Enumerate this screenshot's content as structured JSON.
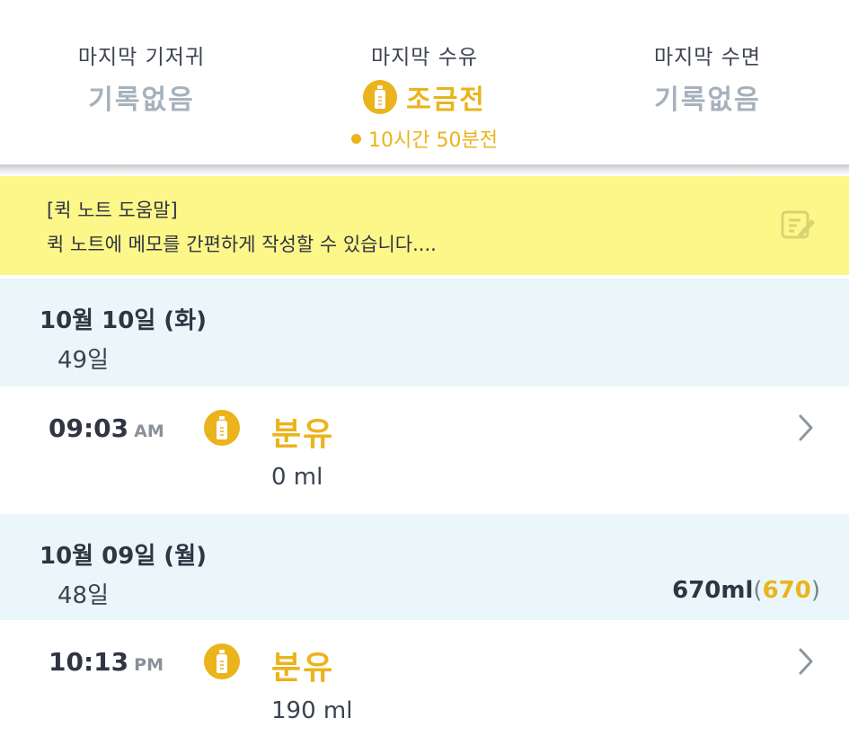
{
  "summary": {
    "diaper": {
      "label": "마지막 기저귀",
      "value": "기록없음"
    },
    "feeding": {
      "label": "마지막 수유",
      "value": "조금전",
      "sub": "10시간 50분전",
      "icon": "bottle-icon"
    },
    "sleep": {
      "label": "마지막 수면",
      "value": "기록없음"
    }
  },
  "quick_note": {
    "title": "[퀵 노트 도움말]",
    "text": "퀵 노트에 메모를 간편하게 작성할 수 있습니다....",
    "icon": "edit-note-icon"
  },
  "days": [
    {
      "date": "10월 10일 (화)",
      "age": "49일",
      "entries": [
        {
          "time": "09:03",
          "ampm": "AM",
          "type": "분유",
          "amount": "0 ml",
          "icon": "bottle-icon"
        }
      ]
    },
    {
      "date": "10월 09일 (월)",
      "age": "48일",
      "total": "670ml",
      "total_open": "(",
      "total_count": "670",
      "total_close": ")",
      "entries": [
        {
          "time": "10:13",
          "ampm": "PM",
          "type": "분유",
          "amount": "190 ml",
          "icon": "bottle-icon"
        }
      ]
    }
  ],
  "colors": {
    "accent": "#ebb31c",
    "muted": "#a7b1bd",
    "note_bg": "#fdf78a",
    "date_bg": "#eaf6fa"
  }
}
